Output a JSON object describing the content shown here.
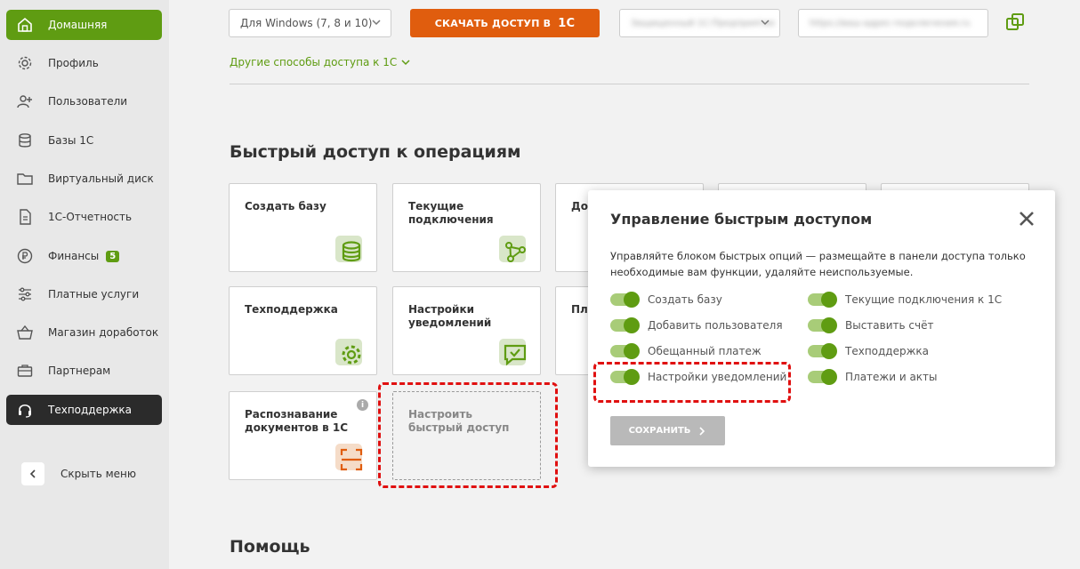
{
  "sidebar": {
    "items": [
      {
        "label": "Домашняя",
        "icon": "home-icon"
      },
      {
        "label": "Профиль",
        "icon": "gear-icon"
      },
      {
        "label": "Пользователи",
        "icon": "add-user-icon"
      },
      {
        "label": "Базы 1С",
        "icon": "database-icon"
      },
      {
        "label": "Виртуальный диск",
        "icon": "folder-icon"
      },
      {
        "label": "1С-Отчетность",
        "icon": "document-icon"
      },
      {
        "label": "Финансы",
        "icon": "ruble-icon",
        "badge": "5"
      },
      {
        "label": "Платные услуги",
        "icon": "sliders-icon"
      },
      {
        "label": "Магазин доработок",
        "icon": "basket-icon"
      },
      {
        "label": "Партнерам",
        "icon": "briefcase-icon"
      },
      {
        "label": "Техподдержка",
        "icon": "headset-icon"
      }
    ],
    "hide_menu": "Скрыть меню"
  },
  "top": {
    "os_select": "Для Windows (7, 8 и 10)",
    "download_label": "СКАЧАТЬ ДОСТУП В",
    "download_logo": "1С",
    "blurred_select": "Защищенный 1С:Предприятие",
    "blurred_input": "https://ваш-адрес-подключения.ru",
    "other_ways": "Другие способы доступа к 1С"
  },
  "quick": {
    "title": "Быстрый доступ к операциям",
    "tiles": [
      {
        "label": "Создать базу",
        "icon": "database-icon"
      },
      {
        "label": "Текущие подключения",
        "icon": "network-icon"
      },
      {
        "label": "Доб",
        "icon": ""
      },
      {
        "label": "",
        "icon": ""
      },
      {
        "label": "",
        "icon": ""
      },
      {
        "label": "Техподдержка",
        "icon": "gear-icon"
      },
      {
        "label": "Настройки уведомлений",
        "icon": "chat-check-icon"
      },
      {
        "label": "Пла",
        "icon": ""
      },
      {
        "label": "Распознавание документов в 1С",
        "icon": "scan-icon"
      },
      {
        "label": "Настроить быстрый доступ",
        "icon": ""
      }
    ]
  },
  "help": {
    "title": "Помощь"
  },
  "modal": {
    "title": "Управление быстрым доступом",
    "description": "Управляйте блоком быстрых опций — размещайте в панели доступа только необходимые вам функции, удаляйте неиспользуемые.",
    "options_left": [
      "Создать базу",
      "Добавить пользователя",
      "Обещанный платеж",
      "Настройки уведомлений"
    ],
    "options_right": [
      "Текущие подключения к 1С",
      "Выставить счёт",
      "Техподдержка",
      "Платежи и акты"
    ],
    "save": "СОХРАНИТЬ"
  },
  "colors": {
    "accent": "#5f9c12",
    "download": "#e05d0e",
    "highlight": "#e01010"
  }
}
